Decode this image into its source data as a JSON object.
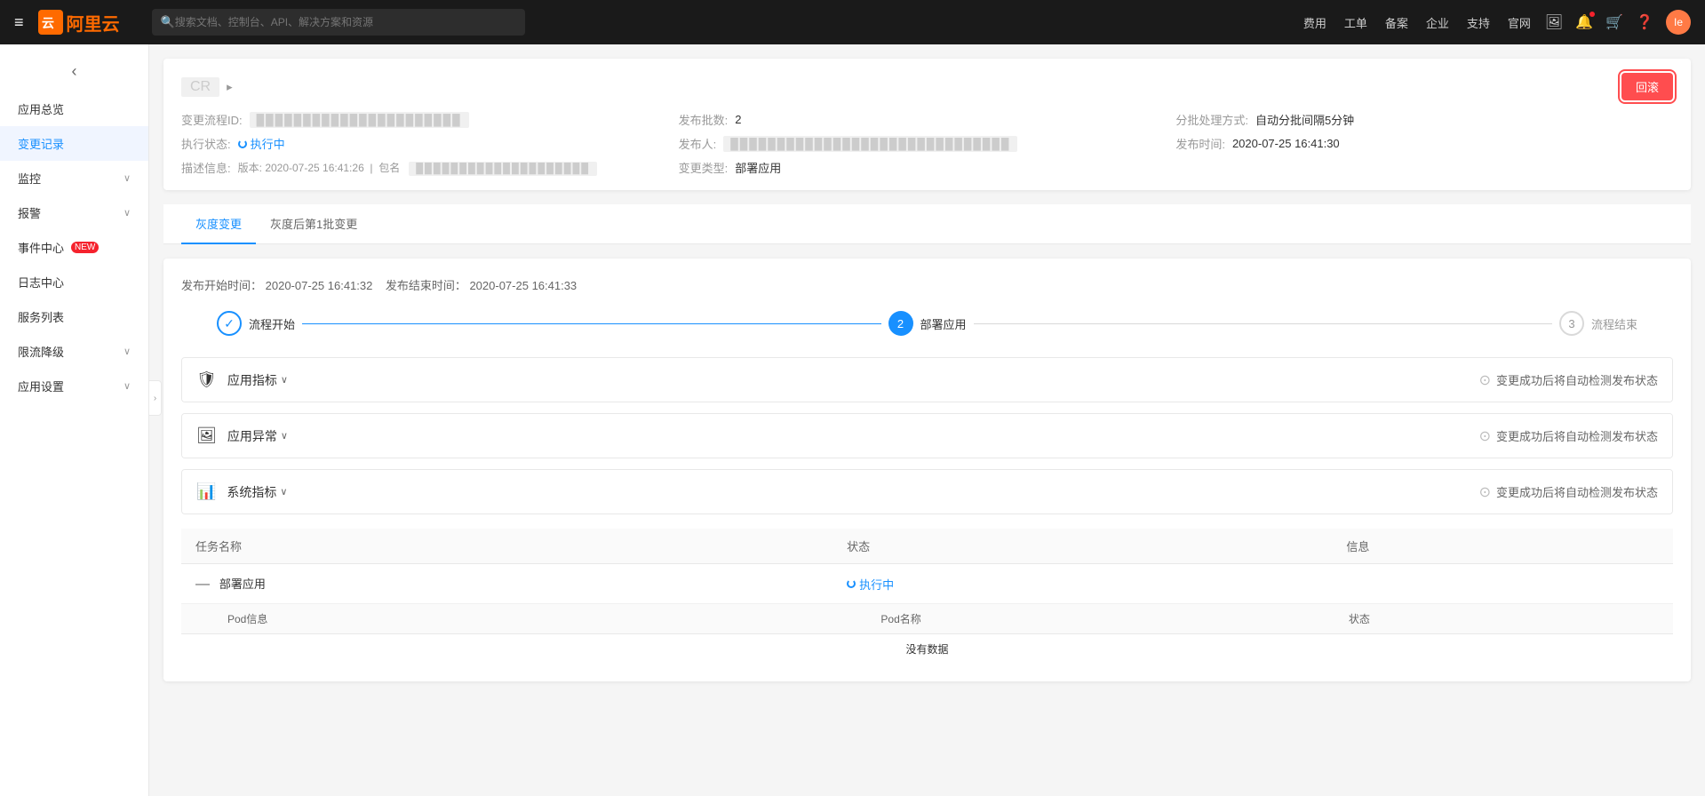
{
  "nav": {
    "menu_icon": "≡",
    "logo_text": "阿里云",
    "search_placeholder": "搜索文档、控制台、API、解决方案和资源",
    "links": [
      "费用",
      "工单",
      "备案",
      "企业",
      "支持",
      "官网"
    ],
    "user_initial": "Ie"
  },
  "sidebar": {
    "back_icon": "‹",
    "items": [
      {
        "label": "应用总览",
        "active": false,
        "has_arrow": false,
        "badge": null
      },
      {
        "label": "变更记录",
        "active": true,
        "has_arrow": false,
        "badge": null
      },
      {
        "label": "监控",
        "active": false,
        "has_arrow": true,
        "badge": null
      },
      {
        "label": "报警",
        "active": false,
        "has_arrow": true,
        "badge": null
      },
      {
        "label": "事件中心",
        "active": false,
        "has_arrow": false,
        "badge": "NEW"
      },
      {
        "label": "日志中心",
        "active": false,
        "has_arrow": false,
        "badge": null
      },
      {
        "label": "服务列表",
        "active": false,
        "has_arrow": false,
        "badge": null
      },
      {
        "label": "限流降级",
        "active": false,
        "has_arrow": true,
        "badge": null
      },
      {
        "label": "应用设置",
        "active": false,
        "has_arrow": true,
        "badge": null
      }
    ]
  },
  "page": {
    "title": "CR",
    "title_suffix": "▸",
    "return_button": "回滚",
    "meta": {
      "process_id_label": "变更流程ID:",
      "process_id_value": "██████████████████████",
      "exec_status_label": "执行状态:",
      "exec_status_value": "执行中",
      "desc_label": "描述信息:",
      "version_label": "版本:",
      "version_value": "2020-07-25 16:41:26",
      "package_label": "包名",
      "package_value": "████████████████████",
      "publish_count_label": "发布批数:",
      "publish_count_value": "2",
      "publisher_label": "发布人:",
      "publisher_value": "██████████████████████████████",
      "change_type_label": "变更类型:",
      "change_type_value": "部署应用",
      "batch_mode_label": "分批处理方式:",
      "batch_mode_value": "自动分批间隔5分钟",
      "publish_time_label": "发布时间:",
      "publish_time_value": "2020-07-25 16:41:30"
    }
  },
  "tabs": [
    {
      "label": "灰度变更",
      "active": true
    },
    {
      "label": "灰度后第1批变更",
      "active": false
    }
  ],
  "content": {
    "time_range_prefix": "发布开始时间：",
    "start_time": "2020-07-25 16:41:32",
    "time_range_separator": "发布结束时间：",
    "end_time": "2020-07-25 16:41:33",
    "steps": [
      {
        "id": 1,
        "label": "流程开始",
        "status": "done"
      },
      {
        "id": 2,
        "label": "部署应用",
        "status": "active"
      },
      {
        "id": 3,
        "label": "流程结束",
        "status": "pending"
      }
    ],
    "monitor_sections": [
      {
        "icon": "🛡",
        "title": "应用指标",
        "status_text": "变更成功后将自动检测发布状态"
      },
      {
        "icon": "🖼",
        "title": "应用异常",
        "status_text": "变更成功后将自动检测发布状态"
      },
      {
        "icon": "📊",
        "title": "系统指标",
        "status_text": "变更成功后将自动检测发布状态"
      }
    ],
    "table": {
      "columns": [
        "任务名称",
        "状态",
        "信息"
      ],
      "rows": [
        {
          "name": "部署应用",
          "status": "执行中",
          "info": ""
        }
      ],
      "pod_columns": [
        "Pod信息",
        "Pod名称",
        "状态"
      ],
      "no_data": "没有数据"
    }
  }
}
